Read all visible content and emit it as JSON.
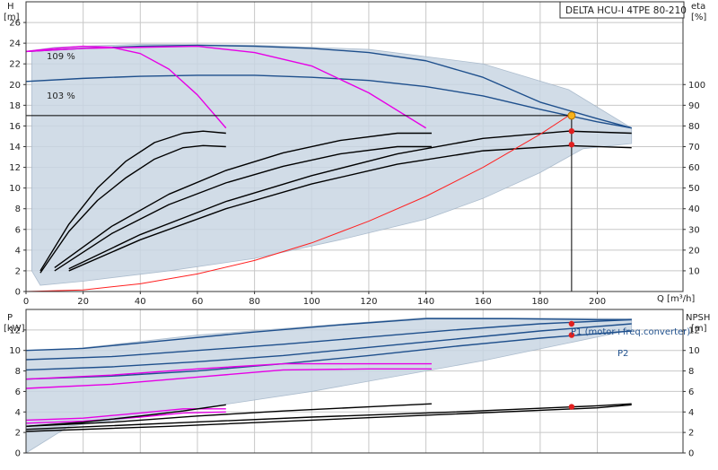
{
  "chart_data": [
    {
      "type": "line",
      "title": "DELTA HCU-I 4TPE 80-210",
      "y_unit_label": "H",
      "y_unit": "[m]",
      "y2_unit_label": "eta",
      "y2_unit": "[%]",
      "x_unit_label": "Q [m³/h]",
      "xlim": [
        0,
        230
      ],
      "ylim": [
        0,
        28
      ],
      "y2lim": [
        0,
        140
      ],
      "x_ticks": [
        0,
        20,
        40,
        60,
        80,
        100,
        120,
        140,
        160,
        180,
        200
      ],
      "y_ticks": [
        0,
        2,
        4,
        6,
        8,
        10,
        12,
        14,
        16,
        18,
        20,
        22,
        24,
        26
      ],
      "y2_ticks": [
        10,
        20,
        30,
        40,
        50,
        60,
        70,
        80,
        90,
        100
      ],
      "annotations": [
        "109 %",
        "103 %"
      ],
      "grid": true,
      "envelope": {
        "x": [
          2,
          10,
          40,
          80,
          120,
          160,
          190,
          212,
          212,
          195,
          180,
          160,
          140,
          110,
          80,
          50,
          20,
          5,
          2
        ],
        "y": [
          23.3,
          23.6,
          23.9,
          23.8,
          23.4,
          22,
          19.5,
          15.8,
          14.3,
          13.8,
          11.5,
          9,
          7,
          5,
          3.2,
          2,
          1,
          0.6,
          2
        ]
      },
      "series": [
        {
          "color": "#1e4f8c",
          "x": [
            0,
            20,
            40,
            60,
            80,
            100,
            120,
            140,
            160,
            180,
            200,
            212
          ],
          "y": [
            23.2,
            23.5,
            23.7,
            23.8,
            23.7,
            23.5,
            23.1,
            22.3,
            20.7,
            18.3,
            16.7,
            15.8
          ]
        },
        {
          "color": "#1e4f8c",
          "x": [
            0,
            20,
            40,
            60,
            80,
            100,
            120,
            140,
            160,
            180,
            200,
            212
          ],
          "y": [
            20.3,
            20.6,
            20.8,
            20.9,
            20.9,
            20.7,
            20.4,
            19.8,
            18.9,
            17.6,
            16.4,
            15.8
          ]
        },
        {
          "color": "#e600e6",
          "x": [
            0,
            10,
            20,
            30,
            40,
            50,
            60,
            70
          ],
          "y": [
            23.2,
            23.5,
            23.7,
            23.6,
            23,
            21.5,
            19,
            15.8
          ]
        },
        {
          "color": "#e600e6",
          "x": [
            0,
            20,
            40,
            60,
            80,
            100,
            120,
            140
          ],
          "y": [
            23.2,
            23.5,
            23.6,
            23.7,
            23.1,
            21.8,
            19.2,
            15.8
          ]
        },
        {
          "color": "#000000",
          "x": [
            5,
            15,
            25,
            35,
            45,
            55,
            62,
            70
          ],
          "y": [
            2,
            6.5,
            10,
            12.6,
            14.4,
            15.3,
            15.5,
            15.3
          ]
        },
        {
          "color": "#000000",
          "x": [
            5,
            15,
            25,
            35,
            45,
            55,
            62,
            70
          ],
          "y": [
            1.8,
            5.8,
            8.8,
            11,
            12.8,
            13.9,
            14.1,
            14
          ]
        },
        {
          "color": "#000000",
          "x": [
            10,
            30,
            50,
            70,
            90,
            110,
            130,
            142
          ],
          "y": [
            2.3,
            6.3,
            9.4,
            11.7,
            13.4,
            14.6,
            15.3,
            15.3
          ]
        },
        {
          "color": "#000000",
          "x": [
            10,
            30,
            50,
            70,
            90,
            110,
            130,
            142
          ],
          "y": [
            2,
            5.6,
            8.4,
            10.5,
            12.1,
            13.3,
            14,
            14
          ]
        },
        {
          "color": "#000000",
          "x": [
            15,
            40,
            70,
            100,
            130,
            160,
            190,
            212
          ],
          "y": [
            2.2,
            5.5,
            8.7,
            11.2,
            13.3,
            14.8,
            15.5,
            15.3
          ]
        },
        {
          "color": "#000000",
          "x": [
            15,
            40,
            70,
            100,
            130,
            160,
            190,
            212
          ],
          "y": [
            2,
            5,
            8,
            10.4,
            12.3,
            13.6,
            14.1,
            13.9
          ]
        },
        {
          "color": "#ff2020",
          "x": [
            0,
            20,
            40,
            60,
            80,
            100,
            120,
            140,
            160,
            180,
            190
          ],
          "y": [
            0,
            0.15,
            0.75,
            1.7,
            3,
            4.7,
            6.8,
            9.2,
            12,
            15.2,
            17
          ]
        }
      ],
      "operating_points": [
        {
          "x": 191,
          "y": 17,
          "color": "#f7b21a"
        },
        {
          "x": 191,
          "y": 15.5,
          "color": "#e02020"
        },
        {
          "x": 191,
          "y": 14.2,
          "color": "#e02020"
        }
      ],
      "duty_line": {
        "x": 191,
        "y": 17
      }
    },
    {
      "type": "line",
      "y_unit_label": "P",
      "y_unit": "[kW]",
      "y2_unit_label": "NPSH",
      "y2_unit": "[m]",
      "xlim": [
        0,
        230
      ],
      "ylim": [
        0,
        14
      ],
      "y_ticks": [
        0,
        2,
        4,
        6,
        8,
        10,
        12
      ],
      "y2_ticks": [
        0,
        2,
        4,
        6,
        8,
        10,
        12
      ],
      "legend_entries": [
        "P1 (motor+freq.converter)",
        "P2"
      ],
      "grid": true,
      "envelope": {
        "x": [
          0,
          15,
          60,
          140,
          212,
          212,
          160,
          100,
          40,
          15,
          0
        ],
        "y": [
          10,
          10.1,
          11.5,
          13.2,
          13.1,
          12,
          9,
          6,
          3.5,
          2.6,
          0
        ]
      },
      "series": [
        {
          "color": "#1e4f8c",
          "x": [
            0,
            20,
            50,
            80,
            110,
            140,
            170,
            200,
            212
          ],
          "y": [
            10,
            10.2,
            11,
            11.8,
            12.5,
            13.1,
            13.1,
            13,
            13
          ]
        },
        {
          "color": "#1e4f8c",
          "x": [
            0,
            30,
            60,
            90,
            120,
            150,
            180,
            212
          ],
          "y": [
            9.1,
            9.4,
            10,
            10.6,
            11.3,
            12,
            12.6,
            13
          ]
        },
        {
          "color": "#1e4f8c",
          "x": [
            0,
            30,
            60,
            90,
            120,
            150,
            180,
            212
          ],
          "y": [
            8.1,
            8.4,
            8.9,
            9.5,
            10.3,
            11.1,
            11.9,
            12.6
          ]
        },
        {
          "color": "#1e4f8c",
          "x": [
            0,
            30,
            60,
            90,
            120,
            150,
            180,
            212
          ],
          "y": [
            7.2,
            7.5,
            8,
            8.7,
            9.5,
            10.4,
            11.2,
            11.9
          ]
        },
        {
          "color": "#e600e6",
          "x": [
            0,
            30,
            60,
            90,
            120,
            142
          ],
          "y": [
            7.2,
            7.6,
            8.2,
            8.7,
            8.7,
            8.7
          ]
        },
        {
          "color": "#e600e6",
          "x": [
            0,
            30,
            60,
            90,
            120,
            142
          ],
          "y": [
            6.3,
            6.7,
            7.4,
            8.1,
            8.2,
            8.2
          ]
        },
        {
          "color": "#e600e6",
          "x": [
            0,
            20,
            40,
            55,
            70
          ],
          "y": [
            3.2,
            3.4,
            3.9,
            4.3,
            4.3
          ]
        },
        {
          "color": "#e600e6",
          "x": [
            0,
            20,
            40,
            55,
            70
          ],
          "y": [
            2.9,
            3.1,
            3.5,
            3.9,
            4
          ]
        },
        {
          "color": "#000000",
          "x": [
            0,
            30,
            60,
            90,
            120,
            142
          ],
          "y": [
            2.6,
            3,
            3.6,
            4.1,
            4.5,
            4.8
          ]
        },
        {
          "color": "#000000",
          "x": [
            0,
            20,
            40,
            55,
            70
          ],
          "y": [
            2.6,
            3,
            3.6,
            4.1,
            4.7
          ]
        },
        {
          "color": "#000000",
          "x": [
            0,
            50,
            100,
            150,
            200,
            212
          ],
          "y": [
            2.3,
            2.9,
            3.5,
            4,
            4.6,
            4.8
          ]
        },
        {
          "color": "#000000",
          "x": [
            0,
            50,
            100,
            150,
            200,
            212
          ],
          "y": [
            2.1,
            2.6,
            3.2,
            3.8,
            4.4,
            4.7
          ]
        }
      ],
      "operating_points": [
        {
          "x": 191,
          "y": 12.6,
          "color": "#e02020"
        },
        {
          "x": 191,
          "y": 11.5,
          "color": "#e02020"
        },
        {
          "x": 191,
          "y": 4.5,
          "color": "#e02020"
        }
      ]
    }
  ],
  "colors": {
    "envelope_fill": "#c9d6e3",
    "envelope_stroke": "#9fb2c6",
    "grid": "#c8c8c8",
    "axis": "#333333",
    "legend_text": "#1e4f8c"
  }
}
